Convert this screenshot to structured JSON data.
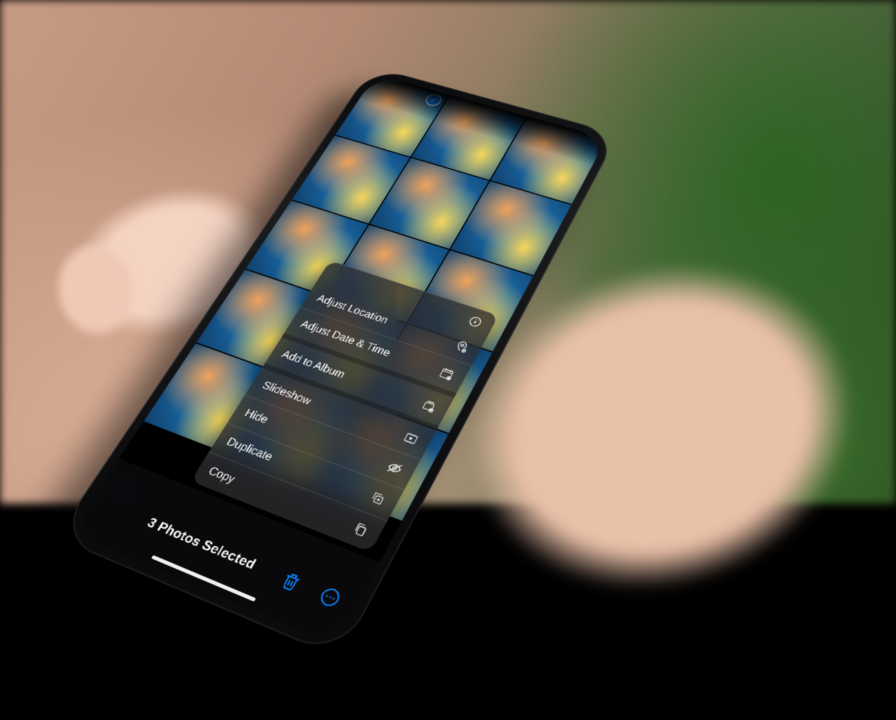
{
  "toolbar": {
    "title": "3 Photos Selected"
  },
  "icons": {
    "share": "share-icon",
    "trash": "trash-icon",
    "more": "ellipsis-circle-icon",
    "info": "info-circle-icon",
    "calendar_plus": "calendar-plus-icon",
    "album": "rectangle-stack-plus-icon",
    "slideshow": "play-rectangle-icon",
    "hide": "eye-slash-icon",
    "duplicate": "plus-square-on-square-icon",
    "copy": "doc-on-doc-icon",
    "checkmark": "checkmark-circle-icon"
  },
  "menu": {
    "info_row": true,
    "groups": [
      [
        {
          "label": "Adjust Location",
          "icon": "calendar_plus"
        },
        {
          "label": "Adjust Date & Time",
          "icon": "calendar_plus"
        }
      ],
      [
        {
          "label": "Add to Album",
          "icon": "album"
        }
      ],
      [
        {
          "label": "Slideshow",
          "icon": "slideshow"
        },
        {
          "label": "Hide",
          "icon": "hide"
        },
        {
          "label": "Duplicate",
          "icon": "duplicate"
        },
        {
          "label": "Copy",
          "icon": "copy"
        }
      ]
    ]
  },
  "grid": {
    "selected_indices": [
      0
    ]
  },
  "colors": {
    "ios_blue": "#0a84ff"
  }
}
